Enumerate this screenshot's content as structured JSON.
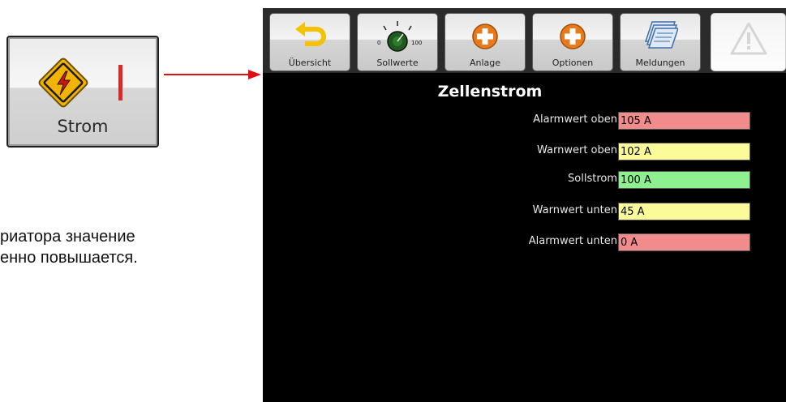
{
  "callout": {
    "button_label": "Strom",
    "icon": "high-voltage-warning-icon",
    "indicator_color": "#d82a2a"
  },
  "text_fragment": [
    "риатора значение",
    "енно повышается."
  ],
  "toolbar": {
    "buttons": [
      {
        "label": "Übersicht",
        "icon": "back-arrow-icon"
      },
      {
        "label": "Sollwerte",
        "icon": "dial-icon",
        "dial_min": "0",
        "dial_max": "100"
      },
      {
        "label": "Anlage",
        "icon": "plus-circle-icon"
      },
      {
        "label": "Optionen",
        "icon": "plus-circle-icon"
      },
      {
        "label": "Meldungen",
        "icon": "messages-icon"
      },
      {
        "label": "",
        "icon": "warning-triangle-icon"
      }
    ]
  },
  "panel": {
    "title": "Zellenstrom",
    "rows": [
      {
        "label": "Alarmwert oben",
        "value": "105 A",
        "color": "#f28c8c"
      },
      {
        "label": "Warnwert oben",
        "value": "102 A",
        "color": "#fbfb9a"
      },
      {
        "label": "Sollstrom",
        "value": "100 A",
        "color": "#8ef08e"
      },
      {
        "label": "Warnwert unten",
        "value": "45 A",
        "color": "#fbfb9a"
      },
      {
        "label": "Alarmwert unten",
        "value": "0 A",
        "color": "#f28c8c"
      }
    ]
  }
}
